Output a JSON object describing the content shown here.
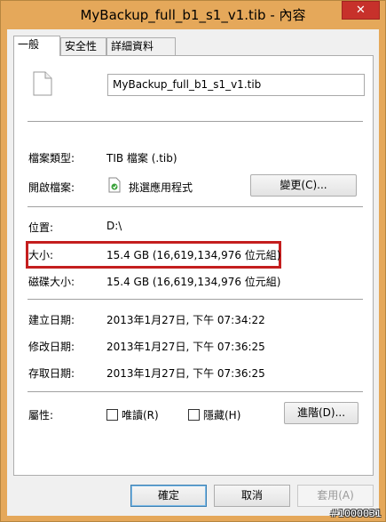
{
  "window": {
    "title": "MyBackup_full_b1_s1_v1.tib - 內容",
    "close_glyph": "✕"
  },
  "tabs": [
    {
      "label": "一般"
    },
    {
      "label": "安全性"
    },
    {
      "label": "詳細資料"
    }
  ],
  "general": {
    "file_name": "MyBackup_full_b1_s1_v1.tib",
    "file_type_label": "檔案類型:",
    "file_type_value": "TIB 檔案 (.tib)",
    "opens_with_label": "開啟檔案:",
    "opens_with_value": "挑選應用程式",
    "change_button": "變更(C)...",
    "location_label": "位置:",
    "location_value": "D:\\",
    "size_label": "大小:",
    "size_value": "15.4 GB (16,619,134,976 位元組)",
    "size_on_disk_label": "磁碟大小:",
    "size_on_disk_value": "15.4 GB (16,619,134,976 位元組)",
    "created_label": "建立日期:",
    "created_value": "2013年1月27日, 下午 07:34:22",
    "modified_label": "修改日期:",
    "modified_value": "2013年1月27日, 下午 07:36:25",
    "accessed_label": "存取日期:",
    "accessed_value": "2013年1月27日, 下午 07:36:25",
    "attributes_label": "屬性:",
    "readonly_label": "唯讀(R)",
    "hidden_label": "隱藏(H)",
    "advanced_button": "進階(D)..."
  },
  "footer": {
    "ok_button": "確定",
    "cancel_button": "取消",
    "apply_button": "套用(A)"
  },
  "watermark": "#1000031",
  "colors": {
    "frame": "#e5a85a",
    "close_button": "#c7312b",
    "highlight_border": "#c41e1e"
  }
}
